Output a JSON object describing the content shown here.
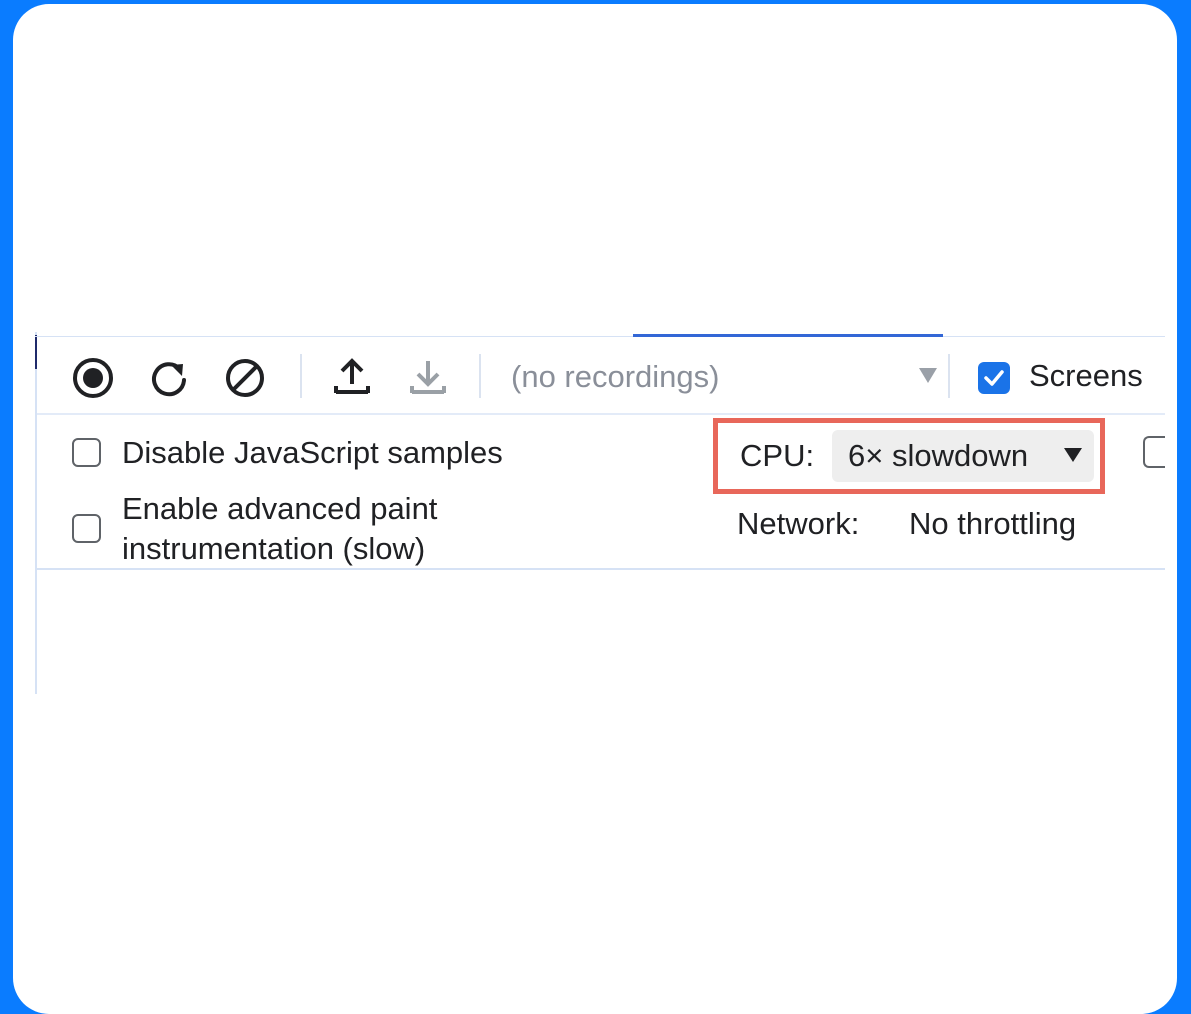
{
  "toolbar": {
    "recordings_placeholder": "(no recordings)",
    "screenshots_label": "Screens",
    "screenshots_checked": true
  },
  "options": {
    "disable_js_samples": "Disable JavaScript samples",
    "enable_paint_line1": "Enable advanced paint",
    "enable_paint_line2": "instrumentation (slow)"
  },
  "throttling": {
    "cpu_label": "CPU:",
    "cpu_value": "6× slowdown",
    "network_label": "Network:",
    "network_value": "No throttling"
  },
  "colors": {
    "background": "#0a7cff",
    "highlight_border": "#e8675a",
    "checkbox_checked": "#1a73e8"
  },
  "icons": [
    "record-icon",
    "reload-icon",
    "clear-icon",
    "upload-icon",
    "download-icon",
    "dropdown-arrow-icon",
    "checkmark-icon"
  ]
}
